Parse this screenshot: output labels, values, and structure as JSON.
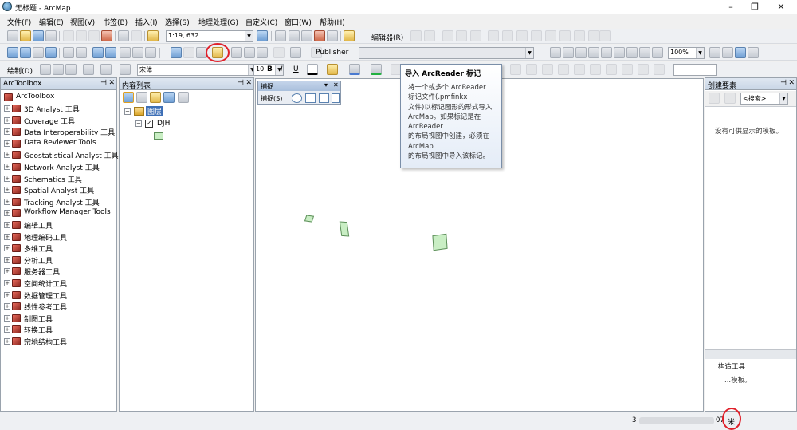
{
  "window": {
    "title": "无标题 - ArcMap",
    "minimize": "–",
    "maximize": "❐",
    "close": "✕"
  },
  "menu": [
    "文件(F)",
    "编辑(E)",
    "视图(V)",
    "书签(B)",
    "插入(I)",
    "选择(S)",
    "地理处理(G)",
    "自定义(C)",
    "窗口(W)",
    "帮助(H)"
  ],
  "toolbar": {
    "scale": "1:19, 632",
    "editor_label": "编辑器(R)",
    "publisher_label": "Publisher",
    "font_name": "宋体",
    "font_size": "10",
    "draw_label": "绘制(D)",
    "bold": "B",
    "italic": "I",
    "underline": "U",
    "zoom_percent": "100%"
  },
  "arctoolbox": {
    "title": "ArcToolbox",
    "root": "ArcToolbox",
    "items": [
      "3D Analyst 工具",
      "Coverage 工具",
      "Data Interoperability 工具",
      "Data Reviewer Tools",
      "Geostatistical Analyst 工具",
      "Network Analyst 工具",
      "Schematics 工具",
      "Spatial Analyst 工具",
      "Tracking Analyst 工具",
      "Workflow Manager Tools",
      "编辑工具",
      "地理编码工具",
      "多维工具",
      "分析工具",
      "服务器工具",
      "空间统计工具",
      "数据管理工具",
      "线性参考工具",
      "制图工具",
      "转换工具",
      "宗地结构工具"
    ]
  },
  "toc": {
    "title": "内容列表",
    "layers_label": "图层",
    "layer_name": "DJH"
  },
  "snapping": {
    "title": "捕捉",
    "menu_label": "捕捉(S)"
  },
  "tooltip": {
    "title": "导入 ArcReader 标记",
    "lines": [
      "将一个或多个 ArcReader",
      "标记文件(.pmfinkx",
      "文件)以标记图形的形式导入",
      "ArcMap。如果标记是在",
      "ArcReader",
      "的布局视图中创建，必须在",
      "ArcMap",
      "的布局视图中导入该标记。"
    ]
  },
  "create_features": {
    "title": "创建要素",
    "search_placeholder": "<搜索>",
    "empty_message": "没有可供显示的模板。",
    "construct_label": "构造工具",
    "construct_message": "...模板。"
  },
  "status": {
    "left_coord": "3",
    "right_coord": "07",
    "unit": "米"
  },
  "colors": {
    "polygon_fill": "#c9eec4",
    "highlight_circle": "#e0202a",
    "panel_header": "#c9d6e6"
  }
}
